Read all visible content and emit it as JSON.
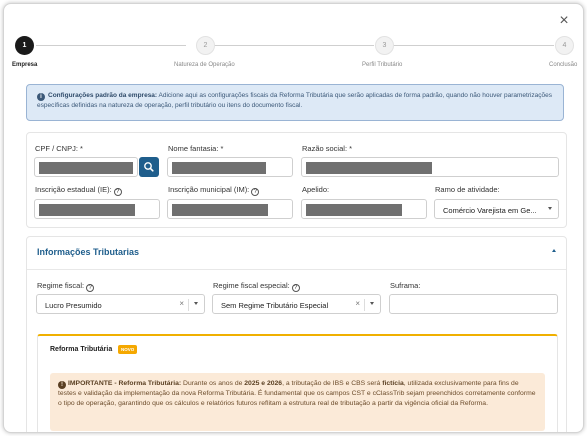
{
  "close_glyph": "×",
  "stepper": {
    "steps": [
      {
        "number": "1",
        "label": "Empresa"
      },
      {
        "number": "2",
        "label": "Natureza de Operação"
      },
      {
        "number": "3",
        "label": "Perfil Tributário"
      },
      {
        "number": "4",
        "label": "Conclusão"
      }
    ],
    "active_index": 0
  },
  "info": {
    "icon": "info-icon",
    "title": "Configurações padrão da empresa:",
    "text": " Adicione aqui as configurações fiscais da Reforma Tributária que serão aplicadas de forma padrão, quando não houver parametrizações específicas definidas na natureza de operação, perfil tributário ou itens do documento fiscal."
  },
  "company": {
    "cnpj_label": "CPF / CNPJ: *",
    "fantasy_label": "Nome fantasia: *",
    "corporate_label": "Razão social: *",
    "state_reg_label": "Inscrição estadual (IE):",
    "city_reg_label": "Inscrição municipal (IM):",
    "nickname_label": "Apelido:",
    "activity_label": "Ramo de atividade:",
    "activity_value": "Comércio Varejista em Ge..."
  },
  "tax": {
    "section_title": "Informações Tributarias",
    "regime_label": "Regime fiscal:",
    "regime_value": "Lucro Presumido",
    "special_label": "Regime fiscal especial:",
    "special_value": "Sem Regime Tributário Especial",
    "suframa_label": "Suframa:",
    "suframa_value": ""
  },
  "reform": {
    "title": "Reforma Tributária",
    "badge": "NOVO",
    "warning": {
      "lead": "IMPORTANTE - Reforma Tributária:",
      "t1": " Durante os anos de ",
      "years": "2025 e 2026",
      "t2": ", a tributação de IBS e CBS será ",
      "fict": "fictícia",
      "t3": ", utilizada exclusivamente para fins de testes e validação da implementação da nova Reforma Tributária. É fundamental que os campos CST e cClassTrib sejam preenchidos corretamente conforme o tipo de operação, garantindo que os cálculos e relatórios futuros reflitam a estrutura real de tributação a partir da vigência oficial da Reforma."
    }
  },
  "colors": {
    "primary": "#1f5e8c",
    "info_bg": "#dde9f6",
    "warning_bg": "#fbead8",
    "badge": "#f5a800"
  }
}
